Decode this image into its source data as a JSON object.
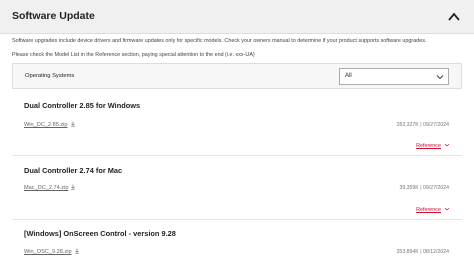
{
  "header": {
    "title": "Software Update",
    "collapse_icon": "chevron-up-icon"
  },
  "notices": [
    "Software upgrades include device drivers and firmware updates only for specific models. Check your owners manual to determine if your product supports software upgrades.",
    "Please check the Model List in the Reference section, paying special attention to the end (i.e. xxx-UA)"
  ],
  "filter": {
    "label": "Operating Systems",
    "selected": "All"
  },
  "items": [
    {
      "title": "Dual Controller 2.85 for Windows",
      "file": "Win_DC_2.85.zip",
      "size": "282,327K",
      "date": "09/27/2024",
      "reference": "Reference"
    },
    {
      "title": "Dual Controller 2.74 for Mac",
      "file": "Mac_DC_2.74.zip",
      "size": "39,359K",
      "date": "09/27/2024",
      "reference": "Reference"
    },
    {
      "title": "[Windows] OnScreen Control - version 9.28",
      "file": "Win_OSC_9.28.zip",
      "size": "353,894K",
      "date": "08/12/2024"
    }
  ],
  "meta_separator": "|",
  "colors": {
    "accent": "#c41230",
    "header_bg": "#f0f0f0"
  }
}
